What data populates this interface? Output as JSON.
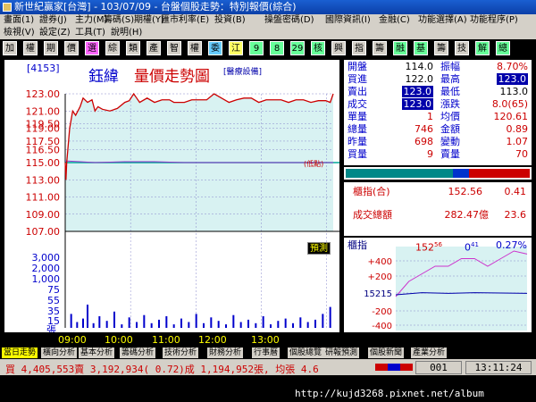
{
  "window": {
    "title": "新世紀贏家[台灣] - 103/07/09 - 台盤個股走勢：特別報價(綜合)"
  },
  "menus": {
    "row1": [
      "畫面(1)",
      "證券(J)",
      "主力(M)",
      "籌碼(S)",
      "期權(Y)",
      "匯市利率(E)",
      "投資(B)",
      "操盤密碼(D)",
      "國際資訊(I)",
      "金融(C)",
      "功能選擇(A)",
      "功能程序(P)"
    ],
    "row2": [
      "檢視(V)",
      "設定(Z)",
      "工具(T)",
      "說明(H)"
    ]
  },
  "toolbar": {
    "buttons": [
      "加",
      "權",
      "期",
      "價",
      "選",
      "綜",
      "類",
      "產",
      "智",
      "權",
      "委",
      "江",
      "9",
      "8",
      "29",
      "核",
      "興",
      "指",
      "籌",
      "融",
      "基",
      "籌",
      "技",
      "解",
      "總"
    ]
  },
  "stock": {
    "id": "[4153]",
    "name": "鈺緯",
    "chart_title": "量價走勢圖",
    "industry": "[醫療設備]"
  },
  "marker": {
    "label": "(低點)"
  },
  "bookmark": "預測",
  "quote": {
    "open_label": "開盤",
    "open": "114.0",
    "amp_label": "振幅",
    "amp": "8.70%",
    "bid_label": "買進",
    "bid": "122.0",
    "high_label": "最高",
    "high": "123.0",
    "ask_label": "賣出",
    "ask": "123.0",
    "low_label": "最低",
    "low": "113.0",
    "last_label": "成交",
    "last": "123.0",
    "chg_label": "漲跌",
    "chg": "8.0(65)",
    "unit_label": "單量",
    "unit": "1",
    "avg_label": "均價",
    "avg": "120.61",
    "vol_label": "總量",
    "vol": "746",
    "amt_label": "金額",
    "amt": "0.89",
    "yvol_label": "昨量",
    "yvol": "698",
    "turn_label": "變動",
    "turn": "1.07",
    "bvol_label": "買量",
    "bvol": "9",
    "svol_label": "賣量",
    "svol": "70"
  },
  "index_panel": {
    "label": "櫃指(合)",
    "value": "152.56",
    "change": "0.41",
    "total_label": "成交總額",
    "total": "282.47億",
    "total_change": "23.6"
  },
  "index_chart": {
    "label": "櫃指",
    "value": "152",
    "value_sup": "56",
    "change": "0",
    "change_sup": "41",
    "pct": "0.27%"
  },
  "tabs": [
    "當日走勢",
    "橫向分析",
    "基本分析",
    "籌碼分析",
    "技術分析",
    "財務分析",
    "行事曆",
    "個股總覽",
    "研報預測",
    "個股新聞",
    "產業分析"
  ],
  "status": {
    "text": "買 4,405,553賣 3,192,934( 0.72)成 1,194,952張, 均張 4.6",
    "count": "001",
    "clock": "13:11:24"
  },
  "watermark": "http://kujd3268.pixnet.net/album",
  "colors": {
    "price_line": "#cc0000",
    "avg_line": "#9933cc",
    "ref_line": "#00aa99",
    "volume": "#0000cc",
    "fill": "#d8f2f2"
  },
  "chart_data": {
    "type": "line",
    "x": [
      "09:00",
      "10:00",
      "11:00",
      "12:00",
      "13:00"
    ],
    "y_ticks": [
      107.0,
      109.0,
      111.0,
      113.0,
      115.0,
      116.5,
      117.5,
      119.0,
      119.5,
      121.0,
      123.0
    ],
    "ylim": [
      107.0,
      123.0
    ],
    "reference": 115.0,
    "price": [
      [
        0,
        115.0
      ],
      [
        0.05,
        113.0
      ],
      [
        0.1,
        115.0
      ],
      [
        0.2,
        117.0
      ],
      [
        0.3,
        119.0
      ],
      [
        0.4,
        120.0
      ],
      [
        0.5,
        121.0
      ],
      [
        0.7,
        120.5
      ],
      [
        1,
        121.5
      ],
      [
        1.2,
        122.5
      ],
      [
        1.5,
        122.0
      ],
      [
        1.8,
        122.3
      ],
      [
        2,
        121.0
      ],
      [
        2.2,
        121.5
      ],
      [
        2.5,
        121.2
      ],
      [
        3,
        121.0
      ],
      [
        3.5,
        121.3
      ],
      [
        4,
        122.0
      ],
      [
        4.3,
        122.2
      ],
      [
        4.6,
        123.0
      ],
      [
        4.8,
        122.5
      ],
      [
        5,
        122.0
      ],
      [
        5.5,
        122.5
      ],
      [
        6,
        122.0
      ],
      [
        6.5,
        122.3
      ],
      [
        7,
        122.3
      ],
      [
        7.3,
        122.0
      ],
      [
        8,
        122.0
      ],
      [
        8.5,
        122.3
      ],
      [
        9,
        122.3
      ],
      [
        9.5,
        122.3
      ],
      [
        10,
        123.0
      ],
      [
        10.5,
        122.5
      ],
      [
        11,
        122.0
      ],
      [
        11.5,
        122.3
      ],
      [
        12,
        122.5
      ],
      [
        12.5,
        122.5
      ],
      [
        13,
        122.0
      ],
      [
        13.5,
        122.3
      ],
      [
        14,
        122.3
      ],
      [
        14.5,
        122.3
      ],
      [
        15,
        122.0
      ],
      [
        15.5,
        122.3
      ],
      [
        16,
        122.3
      ],
      [
        16.5,
        122.0
      ],
      [
        17,
        122.2
      ],
      [
        17.5,
        122.2
      ],
      [
        17.8,
        122.0
      ],
      [
        18,
        123.0
      ]
    ],
    "average": [
      [
        0,
        115.2
      ],
      [
        1,
        115.1
      ],
      [
        2,
        115.0
      ],
      [
        4,
        115.1
      ],
      [
        6,
        115.1
      ],
      [
        8,
        115.0
      ],
      [
        10,
        115.0
      ],
      [
        12,
        115.0
      ],
      [
        14,
        115.0
      ],
      [
        16,
        115.0
      ],
      [
        18,
        115.0
      ]
    ],
    "volume_ticks": [
      15,
      35,
      55,
      75,
      1000,
      2000,
      3000
    ],
    "volume_ylim": [
      0,
      75
    ],
    "volume": [
      [
        0.4,
        12
      ],
      [
        0.8,
        5
      ],
      [
        1.2,
        8
      ],
      [
        1.5,
        20
      ],
      [
        1.9,
        4
      ],
      [
        2.3,
        10
      ],
      [
        2.8,
        6
      ],
      [
        3.3,
        14
      ],
      [
        3.8,
        3
      ],
      [
        4.3,
        9
      ],
      [
        4.8,
        5
      ],
      [
        5.3,
        11
      ],
      [
        5.8,
        4
      ],
      [
        6.3,
        7
      ],
      [
        6.8,
        10
      ],
      [
        7.3,
        3
      ],
      [
        7.8,
        8
      ],
      [
        8.3,
        5
      ],
      [
        8.8,
        12
      ],
      [
        9.3,
        4
      ],
      [
        9.8,
        9
      ],
      [
        10.3,
        6
      ],
      [
        10.8,
        3
      ],
      [
        11.3,
        11
      ],
      [
        11.8,
        5
      ],
      [
        12.3,
        7
      ],
      [
        12.8,
        4
      ],
      [
        13.3,
        10
      ],
      [
        13.8,
        3
      ],
      [
        14.3,
        6
      ],
      [
        14.8,
        8
      ],
      [
        15.3,
        4
      ],
      [
        15.8,
        9
      ],
      [
        16.3,
        5
      ],
      [
        16.8,
        7
      ],
      [
        17.3,
        12
      ],
      [
        17.8,
        18
      ]
    ],
    "index_ticks": [
      "+400",
      "+200",
      "15215",
      "-200",
      "-400"
    ],
    "index_price": [
      [
        0,
        152
      ],
      [
        0.5,
        152.2
      ],
      [
        1,
        152.3
      ],
      [
        1.5,
        152.4
      ],
      [
        2,
        152.4
      ],
      [
        2.5,
        152.5
      ],
      [
        3,
        152.5
      ],
      [
        3.5,
        152.4
      ],
      [
        4,
        152.5
      ],
      [
        4.5,
        152.6
      ],
      [
        5,
        152.56
      ]
    ],
    "index_vol": [
      [
        0,
        0
      ],
      [
        1,
        0.3
      ],
      [
        2,
        0.2
      ],
      [
        3,
        0.3
      ],
      [
        4,
        0.25
      ],
      [
        5,
        0.2
      ]
    ]
  }
}
